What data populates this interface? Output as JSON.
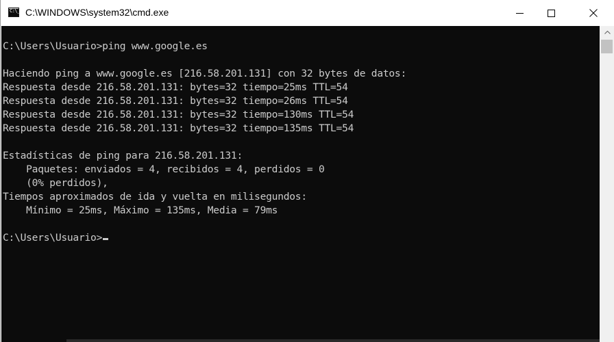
{
  "window": {
    "title": "C:\\WINDOWS\\system32\\cmd.exe",
    "app_icon": "cmd-prompt-icon",
    "icon_glyph": "C:\\_"
  },
  "controls": {
    "minimize_icon": "minimize-icon",
    "maximize_icon": "maximize-icon",
    "close_icon": "close-icon"
  },
  "console": {
    "background": "#0c0c0c",
    "foreground": "#cccccc",
    "lines": [
      "C:\\Users\\Usuario>ping www.google.es",
      "",
      "Haciendo ping a www.google.es [216.58.201.131] con 32 bytes de datos:",
      "Respuesta desde 216.58.201.131: bytes=32 tiempo=25ms TTL=54",
      "Respuesta desde 216.58.201.131: bytes=32 tiempo=26ms TTL=54",
      "Respuesta desde 216.58.201.131: bytes=32 tiempo=130ms TTL=54",
      "Respuesta desde 216.58.201.131: bytes=32 tiempo=135ms TTL=54",
      "",
      "Estadísticas de ping para 216.58.201.131:",
      "    Paquetes: enviados = 4, recibidos = 4, perdidos = 0",
      "    (0% perdidos),",
      "Tiempos aproximados de ida y vuelta en milisegundos:",
      "    Mínimo = 25ms, Máximo = 135ms, Media = 79ms",
      "",
      "C:\\Users\\Usuario>"
    ]
  },
  "scrollbar": {
    "up_icon": "scroll-up-arrow-icon"
  }
}
